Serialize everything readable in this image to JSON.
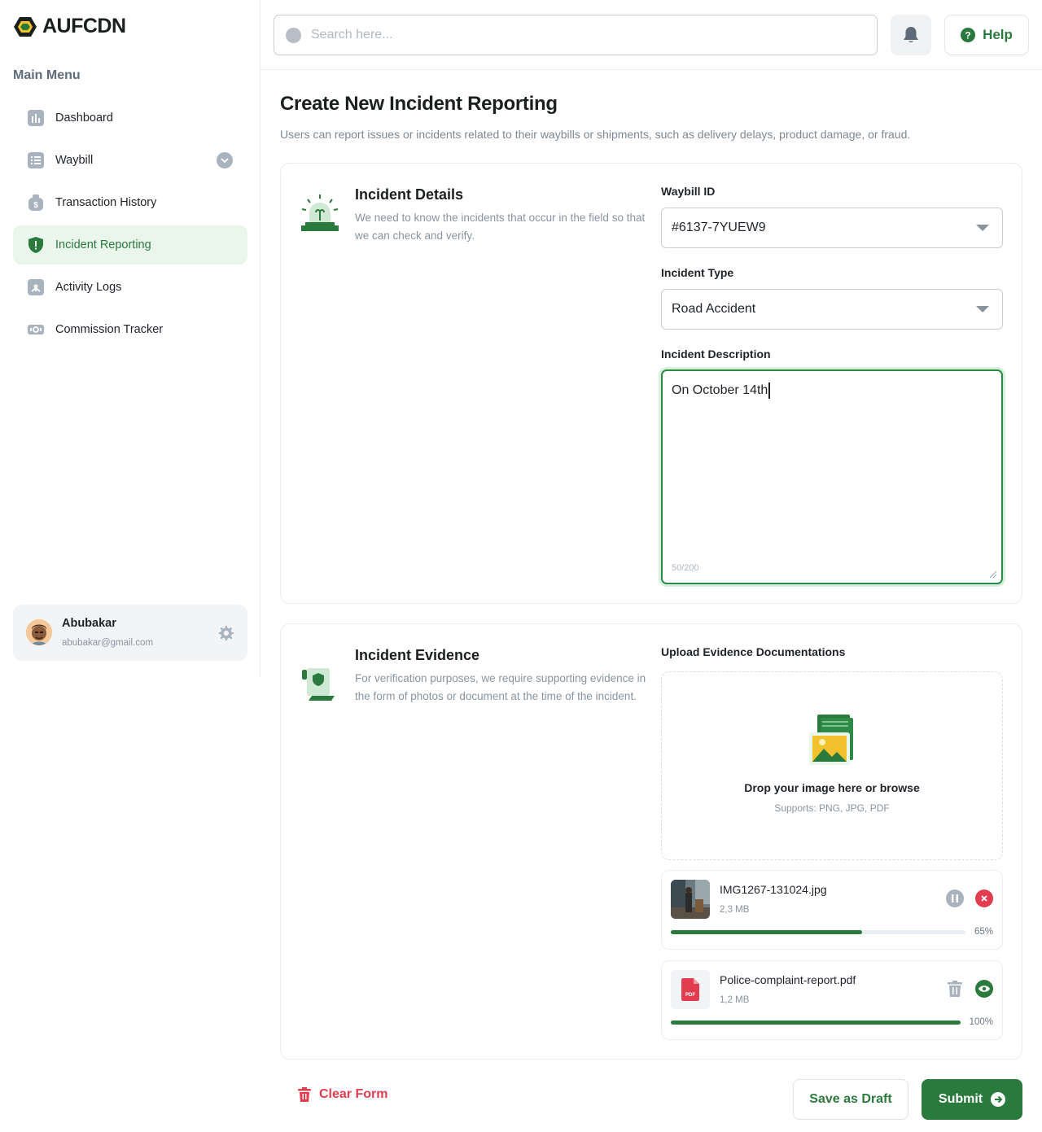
{
  "brand": {
    "name": "AUFCDN"
  },
  "sidebar": {
    "menu_title": "Main Menu",
    "items": [
      {
        "label": "Dashboard",
        "icon": "bar-chart-icon"
      },
      {
        "label": "Waybill",
        "icon": "list-icon"
      },
      {
        "label": "Transaction History",
        "icon": "money-bag-icon"
      },
      {
        "label": "Incident Reporting",
        "icon": "shield-alert-icon",
        "active": true
      },
      {
        "label": "Activity Logs",
        "icon": "activity-icon"
      },
      {
        "label": "Commission Tracker",
        "icon": "cash-icon"
      }
    ],
    "user": {
      "name": "Abubakar",
      "email": "abubakar@gmail.com"
    }
  },
  "topbar": {
    "search_placeholder": "Search here...",
    "help_label": "Help"
  },
  "page": {
    "title": "Create New Incident Reporting",
    "subtitle": "Users can report issues or incidents related to their waybills or shipments, such as delivery delays, product damage, or fraud."
  },
  "incident_details": {
    "title": "Incident Details",
    "description": "We need to know the incidents that occur in the field so that we can check and verify.",
    "waybill_label": "Waybill ID",
    "waybill_value": "#6137-7YUEW9",
    "type_label": "Incident Type",
    "type_value": "Road Accident",
    "desc_label": "Incident Description",
    "desc_value": "On October 14th",
    "desc_counter": "50/200"
  },
  "evidence": {
    "title": "Incident Evidence",
    "description": "For verification purposes, we require supporting evidence in the form of photos or document at the time of the incident.",
    "upload_label": "Upload Evidence Documentations",
    "drop_title": "Drop your image here or browse",
    "drop_sub": "Supports: PNG, JPG, PDF",
    "files": [
      {
        "name": "IMG1267-131024.jpg",
        "size": "2,3 MB",
        "progress": 0.65,
        "progress_label": "65%"
      },
      {
        "name": "Police-complaint-report.pdf",
        "size": "1,2 MB",
        "progress": 1.0,
        "progress_label": "100%",
        "badge": "PDF"
      }
    ]
  },
  "actions": {
    "clear_label": "Clear Form",
    "draft_label": "Save as Draft",
    "submit_label": "Submit"
  },
  "colors": {
    "accent": "#2b7a3d",
    "active_bg": "#eaf5ec",
    "danger": "#e23d4f"
  }
}
